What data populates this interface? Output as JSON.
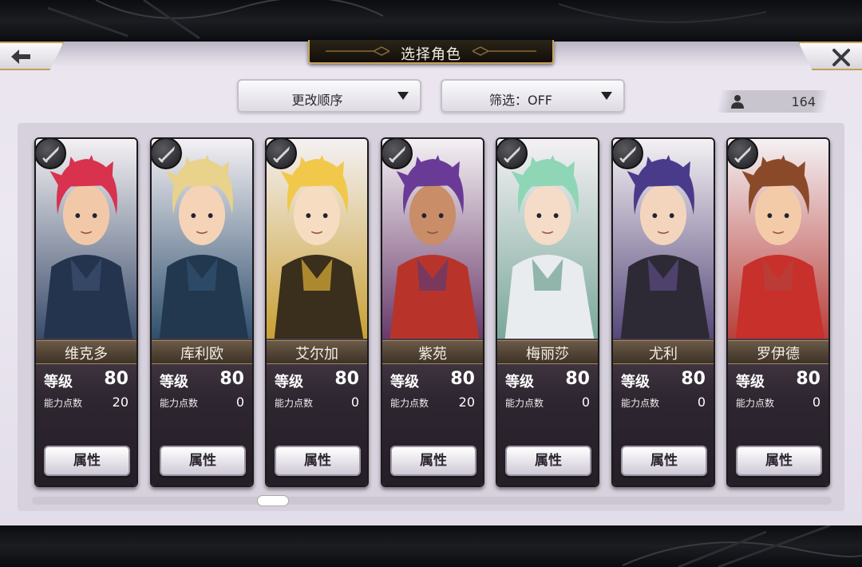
{
  "header": {
    "title": "选择角色",
    "back_icon": "arrow-left-icon",
    "close_icon": "close-x-icon"
  },
  "toolbar": {
    "sort_label": "更改顺序",
    "filter_label": "筛选：OFF",
    "user_count": "164"
  },
  "labels": {
    "level": "等级",
    "ability_points": "能力点数",
    "attributes_button": "属性"
  },
  "characters": [
    {
      "name": "维克多",
      "level": "80",
      "ability_points": "20",
      "theme": "#3a4c6a",
      "hair": "#d8324e",
      "skin": "#f2c9a8",
      "cloth": "#24344f"
    },
    {
      "name": "库利欧",
      "level": "80",
      "ability_points": "0",
      "theme": "#2f4f6d",
      "hair": "#e8d28c",
      "skin": "#f4d3b6",
      "cloth": "#22384f"
    },
    {
      "name": "艾尔加",
      "level": "80",
      "ability_points": "0",
      "theme": "#c9a034",
      "hair": "#f1c84a",
      "skin": "#f6dcc0",
      "cloth": "#3a2e1c"
    },
    {
      "name": "紫苑",
      "level": "80",
      "ability_points": "20",
      "theme": "#6a3a6a",
      "hair": "#6a3b96",
      "skin": "#c98d68",
      "cloth": "#b8342a"
    },
    {
      "name": "梅丽莎",
      "level": "80",
      "ability_points": "0",
      "theme": "#7aa79a",
      "hair": "#8ed6b6",
      "skin": "#f4dcc8",
      "cloth": "#e8ecef"
    },
    {
      "name": "尤利",
      "level": "80",
      "ability_points": "0",
      "theme": "#56487a",
      "hair": "#4a3a8a",
      "skin": "#f3d5bd",
      "cloth": "#2d2a36"
    },
    {
      "name": "罗伊德",
      "level": "80",
      "ability_points": "0",
      "theme": "#b8403a",
      "hair": "#8a4a2a",
      "skin": "#f4cba8",
      "cloth": "#c8302c"
    }
  ],
  "scroll": {
    "position": 0.3
  }
}
